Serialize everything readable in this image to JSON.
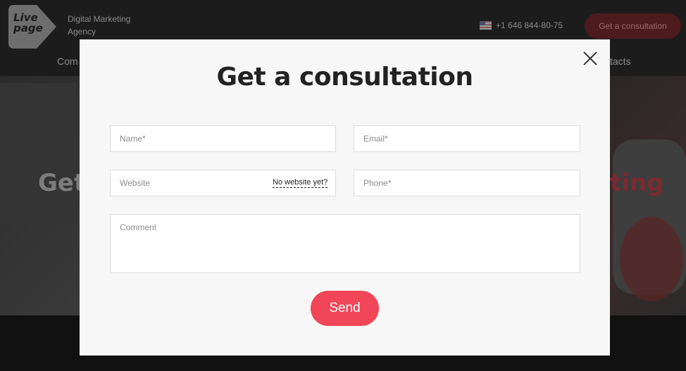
{
  "header": {
    "logo_line1": "Live",
    "logo_line2": "page",
    "tagline": "Digital Marketing Agency",
    "phone": "+1 646 844-80-75",
    "consult_button": "Get a consultation"
  },
  "nav": {
    "left_fragment": "Com",
    "right_fragment": "tacts"
  },
  "hero": {
    "left_fragment": "Get",
    "right_fragment": "ting"
  },
  "modal": {
    "title": "Get a consultation",
    "name_placeholder": "Name*",
    "email_placeholder": "Email*",
    "website_placeholder": "Website",
    "no_website_link": "No website yet?",
    "phone_placeholder": "Phone*",
    "comment_placeholder": "Comment",
    "send_button": "Send"
  },
  "colors": {
    "accent": "#f04657",
    "modal_bg": "#f7f7f7",
    "overlay": "#111111"
  },
  "icons": {
    "close": "close-icon",
    "flag": "us-flag-icon",
    "logo": "livepage-logo"
  }
}
